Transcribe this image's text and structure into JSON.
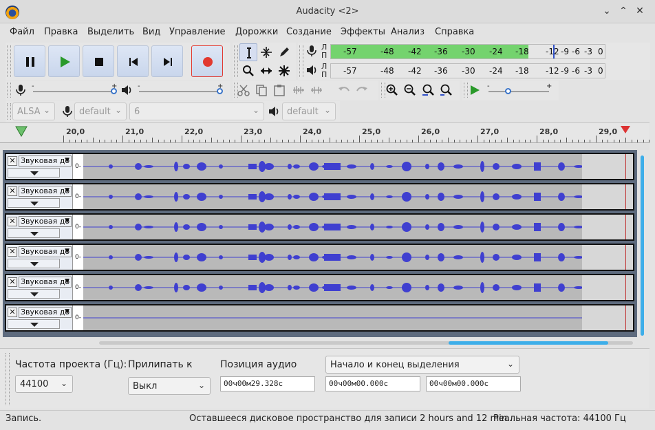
{
  "window": {
    "title": "Audacity <2>"
  },
  "menu": [
    "Файл",
    "Правка",
    "Выделить",
    "Вид",
    "Управление",
    "Дорожки",
    "Создание",
    "Эффекты",
    "Анализ",
    "Справка"
  ],
  "meters": {
    "channel_left": "Л",
    "channel_right": "П",
    "ticks": [
      "-57",
      "-48",
      "-42",
      "-36",
      "-30",
      "-24",
      "-18",
      "-12",
      "-9",
      "-6",
      "-3",
      "0"
    ],
    "recording_level_fraction": 0.72,
    "colors": {
      "fill": "#74d36e",
      "marker": "#3050c8"
    }
  },
  "device": {
    "host": "ALSA",
    "recording_device": "default",
    "channels": "6",
    "playback_device": "default"
  },
  "ruler": {
    "labels": [
      "20,0",
      "21,0",
      "22,0",
      "23,0",
      "24,0",
      "25,0",
      "26,0",
      "27,0",
      "28,0",
      "29,0"
    ]
  },
  "tracks": [
    {
      "name": "Звуковая до",
      "zero": "0-"
    },
    {
      "name": "Звуковая до",
      "zero": "0-"
    },
    {
      "name": "Звуковая до",
      "zero": "0-"
    },
    {
      "name": "Звуковая до",
      "zero": "0-"
    },
    {
      "name": "Звуковая до",
      "zero": "0-"
    },
    {
      "name": "Звуковая до",
      "zero": "0-"
    }
  ],
  "bottom": {
    "rate_label": "Частота проекта (Гц):",
    "rate_value": "44100",
    "snap_label": "Прилипать к",
    "snap_value": "Выкл",
    "position_label": "Позиция аудио",
    "position_value": "00ч00м29.328с",
    "selection_mode": "Начало и конец выделения",
    "selection_start": "00ч00м00.000с",
    "selection_end": "00ч00м00.000с"
  },
  "status": {
    "state": "Запись.",
    "disk_space": "Оставшееся дисковое пространство для записи 2 hours and 12 min...",
    "actual_rate": "Реальная частота: 44100 Гц"
  },
  "colors": {
    "accent": "#3daee9",
    "waveform": "#3f3fd0",
    "record": "#e2392f",
    "play": "#2a9a2a"
  }
}
